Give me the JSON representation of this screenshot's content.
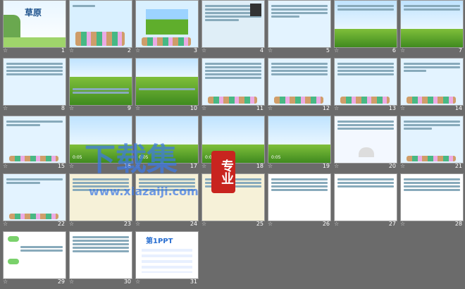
{
  "slides": [
    {
      "n": "1",
      "title": "草原"
    },
    {
      "n": "2"
    },
    {
      "n": "3"
    },
    {
      "n": "4"
    },
    {
      "n": "5"
    },
    {
      "n": "6"
    },
    {
      "n": "7"
    },
    {
      "n": "8"
    },
    {
      "n": "9"
    },
    {
      "n": "10"
    },
    {
      "n": "11"
    },
    {
      "n": "12"
    },
    {
      "n": "13"
    },
    {
      "n": "14"
    },
    {
      "n": "15"
    },
    {
      "n": "16",
      "time": "0:05"
    },
    {
      "n": "17",
      "time": "0:05"
    },
    {
      "n": "18",
      "time": "0:05"
    },
    {
      "n": "19",
      "time": "0:05"
    },
    {
      "n": "20"
    },
    {
      "n": "21"
    },
    {
      "n": "22"
    },
    {
      "n": "23"
    },
    {
      "n": "24"
    },
    {
      "n": "25"
    },
    {
      "n": "26"
    },
    {
      "n": "27"
    },
    {
      "n": "28"
    },
    {
      "n": "29"
    },
    {
      "n": "30"
    },
    {
      "n": "31",
      "brand": "第1PPT"
    }
  ],
  "watermark": {
    "main": "下载集",
    "badge": "专业",
    "url": "www.xiazaiji.com"
  },
  "star_glyph": "☆"
}
